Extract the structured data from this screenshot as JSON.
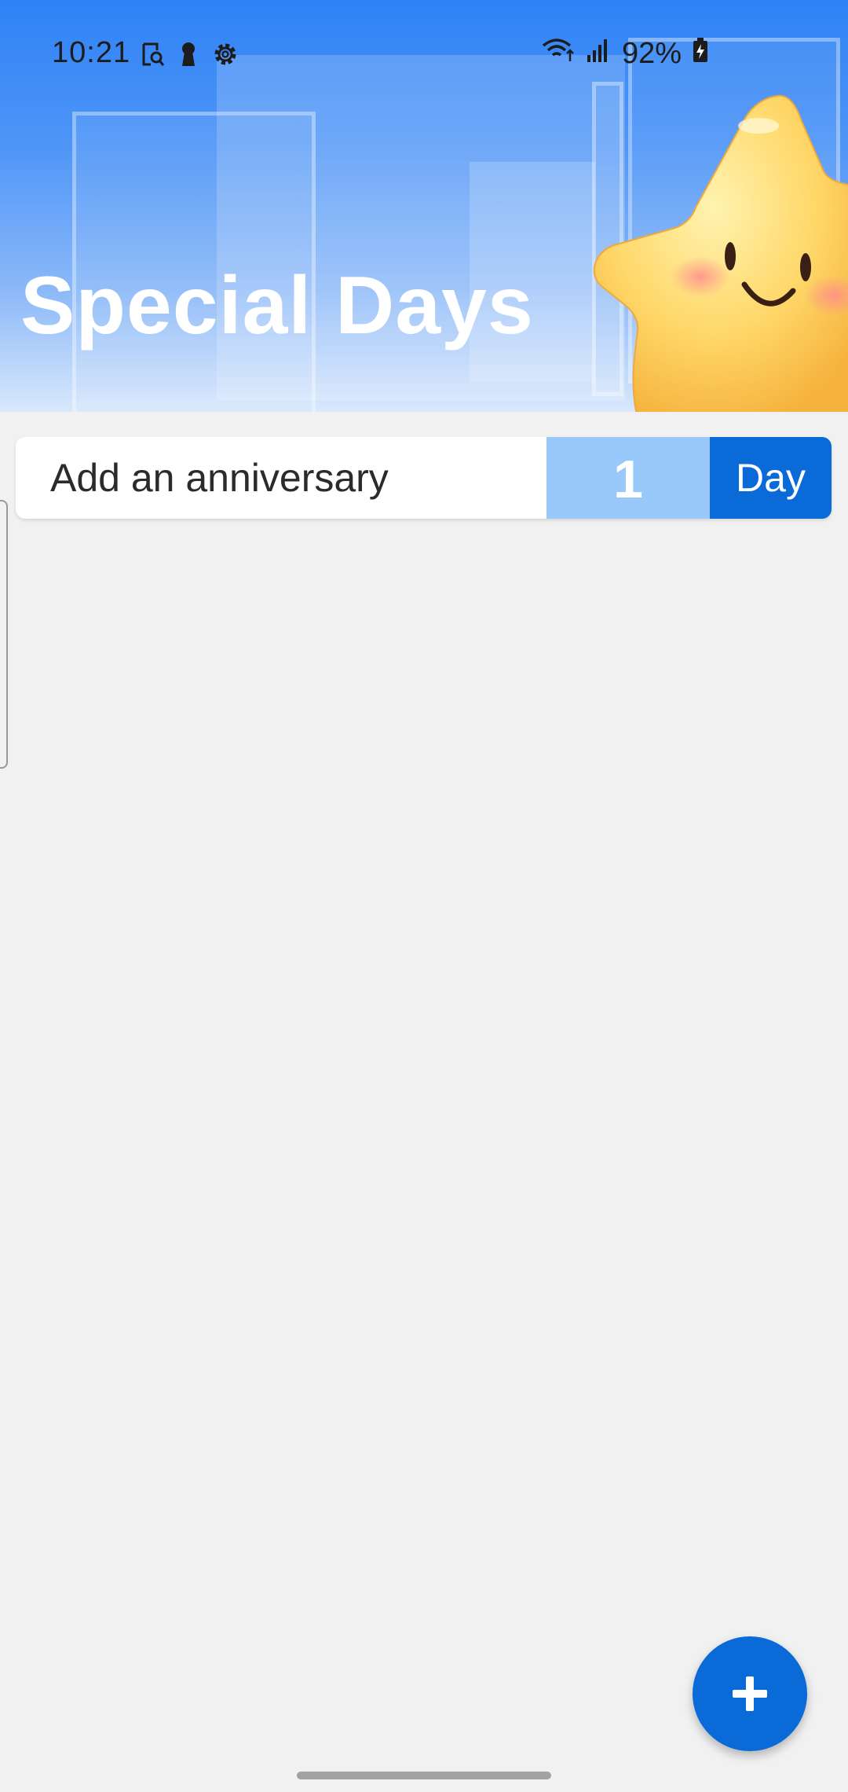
{
  "status_bar": {
    "time": "10:21",
    "battery": "92%",
    "left_icons": [
      "screenshot-icon",
      "keyhole-icon",
      "settings-icon"
    ],
    "right_icons": [
      "wifi-icon",
      "signal-icon",
      "battery-charging-icon"
    ]
  },
  "header": {
    "title": "Special Days",
    "mascot": "star-mascot"
  },
  "anniversary_card": {
    "label": "Add an anniversary",
    "count": "1",
    "unit": "Day"
  },
  "fab": {
    "icon": "plus-icon"
  },
  "colors": {
    "accent": "#0a6ad8",
    "count_bg": "#99c8fb",
    "header_top": "#2f82f6",
    "background": "#f1f1f1"
  }
}
